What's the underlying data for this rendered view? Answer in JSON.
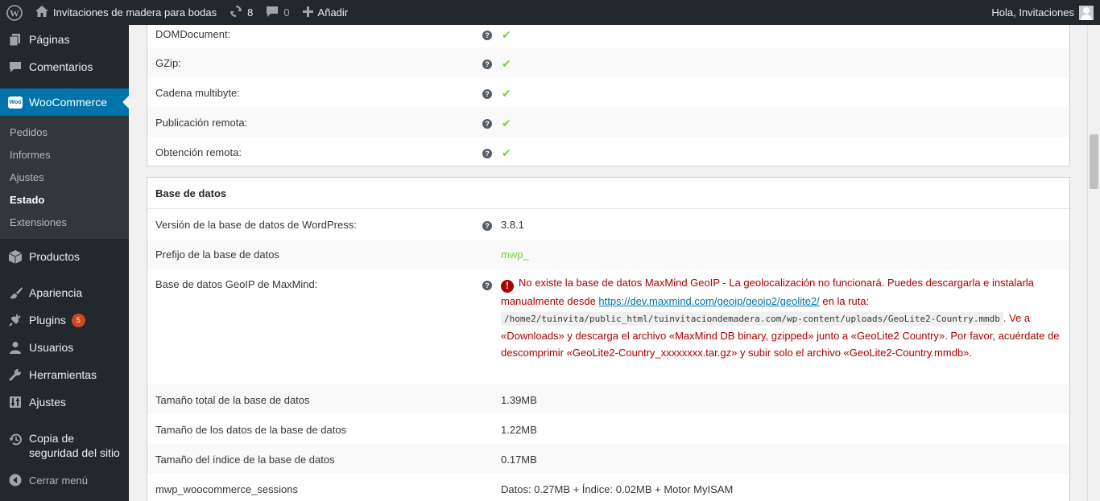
{
  "adminbar": {
    "site_name": "Invitaciones de madera para bodas",
    "updates_count": "8",
    "comments_count": "0",
    "add_new": "Añadir",
    "greeting": "Hola, Invitaciones"
  },
  "sidebar": {
    "items": [
      {
        "label": "Páginas",
        "icon": "pages-icon"
      },
      {
        "label": "Comentarios",
        "icon": "comments-icon"
      },
      {
        "label": "WooCommerce",
        "icon": "woocommerce-icon"
      },
      {
        "label": "Productos",
        "icon": "products-icon"
      },
      {
        "label": "Apariencia",
        "icon": "appearance-icon"
      },
      {
        "label": "Plugins",
        "icon": "plugins-icon",
        "badge": "5"
      },
      {
        "label": "Usuarios",
        "icon": "users-icon"
      },
      {
        "label": "Herramientas",
        "icon": "tools-icon"
      },
      {
        "label": "Ajustes",
        "icon": "settings-icon"
      },
      {
        "label": "Copia de seguridad del sitio",
        "icon": "backup-icon"
      },
      {
        "label": "Cerrar menú",
        "icon": "collapse-icon"
      }
    ],
    "woo_icon_text": "Woo",
    "submenu": [
      "Pedidos",
      "Informes",
      "Ajustes",
      "Estado",
      "Extensiones"
    ]
  },
  "server_env": {
    "rows": [
      {
        "label": "DOMDocument:"
      },
      {
        "label": "GZip:"
      },
      {
        "label": "Cadena multibyte:"
      },
      {
        "label": "Publicación remota:"
      },
      {
        "label": "Obtención remota:"
      }
    ]
  },
  "database": {
    "title": "Base de datos",
    "rows": [
      {
        "label": "Versión de la base de datos de WordPress:",
        "value": "3.8.1"
      },
      {
        "label": "Prefijo de la base de datos",
        "value": "mwp_"
      },
      {
        "label": "Base de datos GeoIP de MaxMind:"
      },
      {
        "label": "Tamaño total de la base de datos",
        "value": "1.39MB"
      },
      {
        "label": "Tamaño de los datos de la base de datos",
        "value": "1.22MB"
      },
      {
        "label": "Tamaño del índice de la base de datos",
        "value": "0.17MB"
      },
      {
        "label": "mwp_woocommerce_sessions",
        "value": "Datos: 0.27MB + Índice: 0.02MB + Motor MyISAM"
      }
    ],
    "geoip": {
      "part1": "No existe la base de datos MaxMind GeoIP - La geolocalización no funcionará. Puedes descargarla e instalarla manualmente desde ",
      "link": "https://dev.maxmind.com/geoip/geoip2/geolite2/",
      "part2": " en la ruta: ",
      "path": "/home2/tuinvita/public_html/tuinvitaciondemadera.com/wp-content/uploads/GeoLite2-Country.mmdb",
      "part3": ". Ve a «Downloads» y descarga el archivo «MaxMind DB binary, gzipped» junto a «GeoLite2 Country». Por favor, acuérdate de descomprimir «GeoLite2-Country_xxxxxxxx.tar.gz» y subir solo el archivo «GeoLite2-Country.mmdb»."
    }
  },
  "colors": {
    "accent": "#0073aa",
    "sidebar_bg": "#23282d",
    "success": "#7ad03a",
    "error": "#aa0000"
  }
}
